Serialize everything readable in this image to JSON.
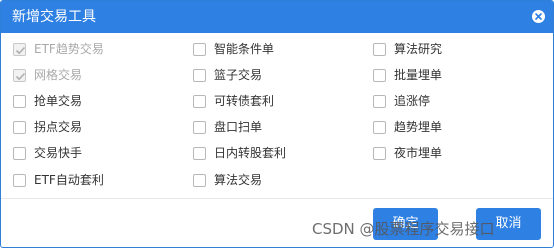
{
  "dialog": {
    "title": "新增交易工具",
    "accent_color": "#2f80e3"
  },
  "options": [
    {
      "label": "ETF趋势交易",
      "checked": true,
      "disabled": true
    },
    {
      "label": "智能条件单",
      "checked": false,
      "disabled": false
    },
    {
      "label": "算法研究",
      "checked": false,
      "disabled": false
    },
    {
      "label": "网格交易",
      "checked": true,
      "disabled": true
    },
    {
      "label": "篮子交易",
      "checked": false,
      "disabled": false
    },
    {
      "label": "批量埋单",
      "checked": false,
      "disabled": false
    },
    {
      "label": "抢单交易",
      "checked": false,
      "disabled": false
    },
    {
      "label": "可转债套利",
      "checked": false,
      "disabled": false
    },
    {
      "label": "追涨停",
      "checked": false,
      "disabled": false
    },
    {
      "label": "拐点交易",
      "checked": false,
      "disabled": false
    },
    {
      "label": "盘口扫单",
      "checked": false,
      "disabled": false
    },
    {
      "label": "趋势埋单",
      "checked": false,
      "disabled": false
    },
    {
      "label": "交易快手",
      "checked": false,
      "disabled": false
    },
    {
      "label": "日内转股套利",
      "checked": false,
      "disabled": false
    },
    {
      "label": "夜市埋单",
      "checked": false,
      "disabled": false
    },
    {
      "label": "ETF自动套利",
      "checked": false,
      "disabled": false
    },
    {
      "label": "算法交易",
      "checked": false,
      "disabled": false
    }
  ],
  "buttons": {
    "ok_label": "确定",
    "cancel_label": "取消"
  },
  "watermark": "CSDN @股票程序交易接口"
}
